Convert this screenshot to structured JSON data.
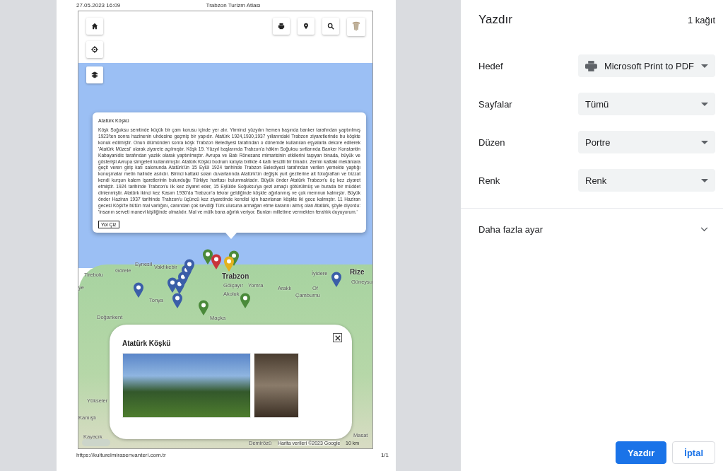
{
  "preview": {
    "header_date": "27.05.2023 16:09",
    "header_title": "Trabzon Turizm Atlası",
    "footer_url": "https://kulturelmirasenvanteri.com.tr",
    "footer_page": "1/1",
    "map": {
      "place_labels": [
        "Eynesil",
        "Vakfıkebir",
        "Görele",
        "Tirebolu",
        "ye",
        "Trabzon",
        "Gölçayır",
        "Yomra",
        "Araklı",
        "Of",
        "Çamburnu",
        "İyidere",
        "Rize",
        "Güneysu",
        "Tonya",
        "Akoluk",
        "Doğankent",
        "Maçka",
        "Yükseler",
        "Kamışlı",
        "Kayacık",
        "Masat",
        "Demirözü"
      ],
      "markers": [
        {
          "color": "#3b5ea8"
        },
        {
          "color": "#3b5ea8"
        },
        {
          "color": "#3b5ea8"
        },
        {
          "color": "#3b5ea8"
        },
        {
          "color": "#3b5ea8"
        },
        {
          "color": "#3b5ea8"
        },
        {
          "color": "#3b5ea8"
        },
        {
          "color": "#3b5ea8"
        },
        {
          "color": "#4a8a3a"
        },
        {
          "color": "#4a8a3a"
        },
        {
          "color": "#4a8a3a"
        },
        {
          "color": "#4a8a3a"
        },
        {
          "color": "#c8333a"
        },
        {
          "color": "#e2b21f"
        }
      ],
      "attribution": "Harita verileri ©2023 Google",
      "scale": "10 km",
      "info_popup": {
        "title": "Atatürk Köşkü",
        "text": "Köşk Soğuksu semtinde küçük bir çam korusu içinde yer alır. Yirminci yüzyılın hemen başında banker tarafından yaptırılmış 1923'ten sonra hazinenin uhdesine geçmiş bir yapıdır. Atatürk 1924,1930,1937 yıllarındaki Trabzon ziyaretlerinde bu köşkte konuk edilmiştir. Onun ölümünden sonra köşk Trabzon Belediyesi tarafından o dönemde kullanılan eşyalarla dekore edilerek 'Atatürk Müzesi' olarak ziyarete açılmıştır. Köşk 19. Yüzyıl başlarında Trabzon'a hâkim Soğuksu sırtlarında Banker Konstantin Kabayanidis tarafından yazlık olarak yaptırılmıştır. Avrupa ve Batı Rönesans mimarisinin etkilerini taşıyan binada, büyük ve gösterişli Avrupa simgeleri kullanılmıştır. Atatürk Köşkü bodrum katıyla birlikte 4 katlı tescilli bir binadır. Zemin kattaki mekânlara geçit veren giriş katı salonunda Atatürk'ün 15 Eylül 1924 tarihinde Trabzon Belediyesi tarafından verilen yemekte yaptığı konuşmalar metin halinde asılıdır. Birinci kattaki solan duvarlarında Atatürk'ün değişik yurt gezilerine ait fotoğrafları ve bizzat kendi kurşun kalem işaretlerinin bulunduğu Türkiye haritası bulunmaktadır. Büyük önder Atatürk Trabzon'u üç kez ziyaret etmiştir. 1924 tarihinde Trabzon'u ilk kez ziyaret eder, 15 Eylülde Soğuksu'ya gezi amaçlı götürülmüş ve burada bir müddet dinlenmiştir. Atatürk ikinci kez Kasım 1930'da Trabzon'a tekrar geldiğinde köşkte ağırlanmış ve çok memnun kalmıştır. Büyük önder Haziran 1937 tarihinde Trabzon'u üçüncü kez ziyaretinde kendisi için hazırlanan köşkte iki gece kalmıştır. 11 Haziran gecesi Köşk'te bütün mal varlığını, canından çok sevdiği Türk ulusuna armağan etme kararını almış olan Atatürk, şöyle diyordu: 'İnsanın serveti manevi kişiliğinde olmalıdır. Mal ve mülk bana ağırlık veriyor. Bunları milletime vermekten ferahlık duyuyorum.'",
        "button": "Yol Çiz"
      },
      "detail_card": {
        "title": "Atatürk Köşkü"
      }
    }
  },
  "print_panel": {
    "title": "Yazdır",
    "sheets": "1 kağıt",
    "settings": [
      {
        "label": "Hedef",
        "value": "Microsoft Print to PDF",
        "kind": "printer"
      },
      {
        "label": "Sayfalar",
        "value": "Tümü",
        "kind": "select"
      },
      {
        "label": "Düzen",
        "value": "Portre",
        "kind": "select"
      },
      {
        "label": "Renk",
        "value": "Renk",
        "kind": "select"
      }
    ],
    "more_settings": {
      "label": "Daha fazla ayar",
      "expanded": false
    },
    "buttons": [
      {
        "label": "Yazdır",
        "kind": "primary"
      },
      {
        "label": "İptal",
        "kind": "secondary"
      }
    ]
  }
}
